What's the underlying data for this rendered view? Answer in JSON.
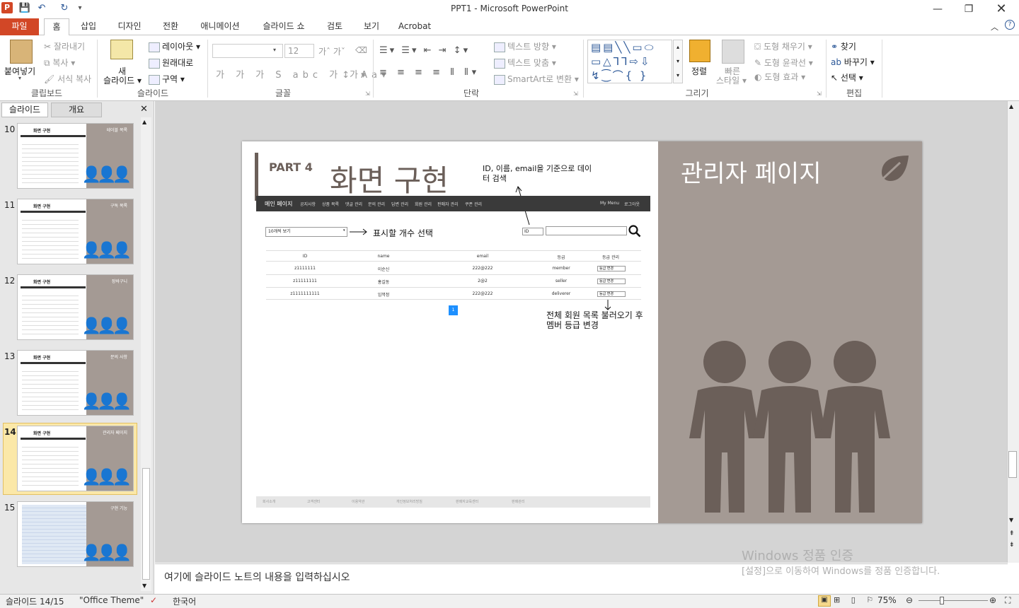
{
  "window": {
    "title": "PPT1  -  Microsoft PowerPoint"
  },
  "tabs": [
    "파일",
    "홈",
    "삽입",
    "디자인",
    "전환",
    "애니메이션",
    "슬라이드 쇼",
    "검토",
    "보기",
    "Acrobat"
  ],
  "ribbon": {
    "clipboard": {
      "paste": "붙여넣기",
      "cut": "잘라내기",
      "copy": "복사",
      "format_painter": "서식 복사",
      "label": "클립보드"
    },
    "slides": {
      "new_slide_1": "새",
      "new_slide_2": "슬라이드",
      "layout": "레이아웃",
      "reset": "원래대로",
      "section": "구역",
      "label": "슬라이드"
    },
    "font": {
      "size": "12",
      "label": "글꼴"
    },
    "paragraph": {
      "text_direction": "텍스트 방향",
      "align_text": "텍스트 맞춤",
      "smartart": "SmartArt로 변환",
      "label": "단락"
    },
    "drawing": {
      "arrange": "정렬",
      "quick_styles_1": "빠른",
      "quick_styles_2": "스타일",
      "shape_fill": "도형 채우기",
      "shape_outline": "도형 윤곽선",
      "shape_effects": "도형 효과",
      "label": "그리기"
    },
    "editing": {
      "find": "찾기",
      "replace": "바꾸기",
      "select": "선택",
      "label": "편집"
    }
  },
  "left_pane": {
    "tab_slides": "슬라이드",
    "tab_outline": "개요",
    "thumbnails": [
      {
        "num": "10",
        "title": "화면 구현",
        "right_title": "테이블 목록"
      },
      {
        "num": "11",
        "title": "화면 구현",
        "right_title": "구독 목록"
      },
      {
        "num": "12",
        "title": "화면 구현",
        "right_title": "장바구니"
      },
      {
        "num": "13",
        "title": "화면 구현",
        "right_title": "문의 사항"
      },
      {
        "num": "14",
        "title": "화면 구현",
        "right_title": "관리자 페이지"
      },
      {
        "num": "15",
        "title": "",
        "right_title": "구현 기능"
      }
    ]
  },
  "slide": {
    "part": "PART 4",
    "title": "화면 구현",
    "right_title": "관리자 페이지",
    "annot_search": "ID, 이름, email을 기준으로 데이터 검색",
    "annot_count": "표시할 개수 선택",
    "annot_member": "전체 회원 목록 불러오기 후 멤버 등급 변경",
    "nav_main": "메인 페이지",
    "nav_items": [
      "공지사항",
      "상품 목록",
      "댓글 관리",
      "문의 관리",
      "답변 관리",
      "회원 관리",
      "판매자 관리",
      "쿠폰 관리"
    ],
    "nav_right": [
      "My Menu",
      "로그아웃"
    ],
    "count_select": "10개씩 보기",
    "search_select": "ID",
    "table_headers": [
      "ID",
      "name",
      "email",
      "등급",
      "등급 관리"
    ],
    "table_rows": [
      [
        "z1111111",
        "이순신",
        "222@222",
        "member",
        "등급 변경"
      ],
      [
        "z11111111",
        "홍길동",
        "2@2",
        "seller",
        "등급 변경"
      ],
      [
        "z1111111111",
        "임꺽정",
        "222@222",
        "deliverer",
        "등급 변경"
      ]
    ],
    "page": "1",
    "footer_items": [
      "회사소개",
      "고객센터",
      "이용약관",
      "개인정보처리방침",
      "판매자교육센터",
      "판매관리"
    ]
  },
  "notes": {
    "placeholder": "여기에 슬라이드 노트의 내용을 입력하십시오"
  },
  "activation": {
    "line1": "Windows 정품 인증",
    "line2": "[설정]으로 이동하여 Windows를 정품 인증합니다."
  },
  "status": {
    "slide": "슬라이드 14/15",
    "theme": "\"Office Theme\"",
    "lang": "한국어",
    "zoom": "75%"
  },
  "colors": {
    "accent": "#d24726",
    "slide_panel": "#a49a94",
    "people": "#6b5f59",
    "selection": "#fbe8a8"
  }
}
